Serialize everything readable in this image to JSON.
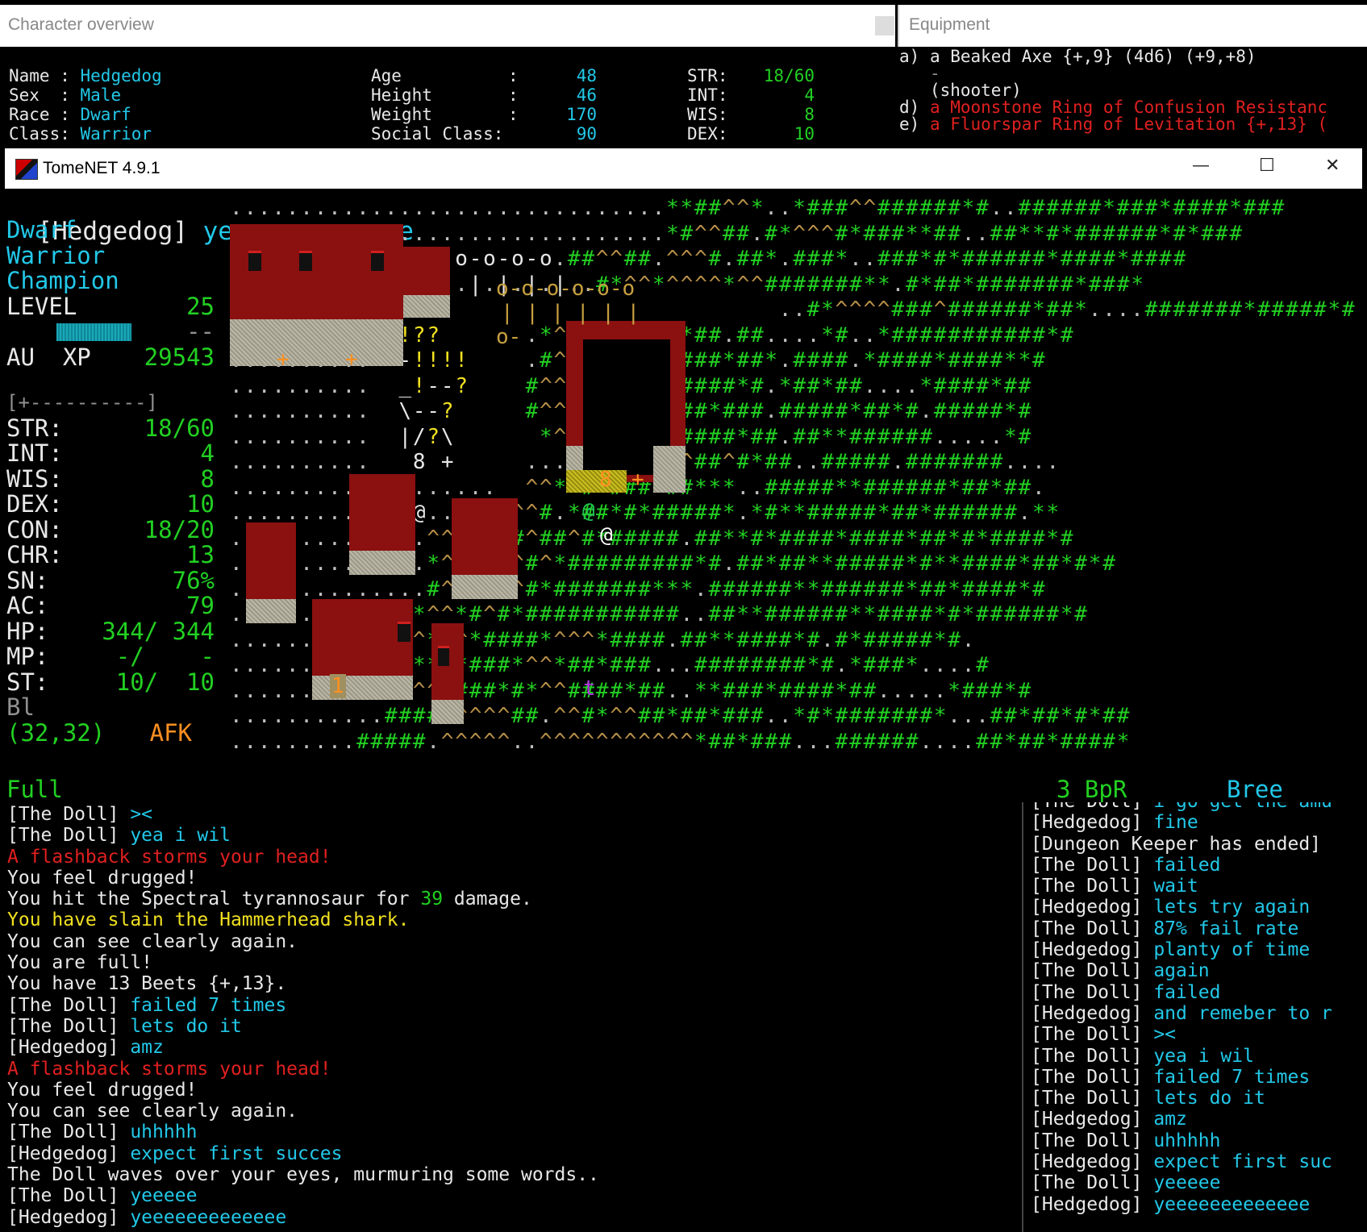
{
  "char_window": {
    "title": "Character overview",
    "name_label": "Name",
    "name": "Hedgedog",
    "sex_label": "Sex",
    "sex": "Male",
    "race_label": "Race",
    "race": "Dwarf",
    "class_label": "Class:",
    "class": "Warrior",
    "age_label": "Age",
    "age": "48",
    "height_label": "Height",
    "height": "46",
    "weight_label": "Weight",
    "weight": "170",
    "social_label": "Social Class:",
    "social": "90",
    "str_label": "STR:",
    "str": "18/60",
    "int_label": "INT:",
    "int": "4",
    "wis_label": "WIS:",
    "wis": "8",
    "dex_label": "DEX:",
    "dex": "10"
  },
  "equip_window": {
    "title": "Equipment",
    "lines": [
      {
        "slot": "a)",
        "text": "a Beaked Axe {+,9} (4d6) (+9,+8)",
        "color": "white"
      },
      {
        "slot": "",
        "text": "-",
        "color": "gray"
      },
      {
        "slot": "",
        "text": "(shooter)",
        "color": "white"
      },
      {
        "slot": "d)",
        "text": "a Moonstone Ring of Confusion Resistanc",
        "color": "red"
      },
      {
        "slot": "e)",
        "text": "a Fluorspar Ring of Levitation {+,13} (",
        "color": "red"
      }
    ]
  },
  "main_window": {
    "title": "TomeNET 4.9.1",
    "minimize": "—",
    "maximize": "☐",
    "close": "✕"
  },
  "top_message": {
    "speaker": "[Hedgedog]",
    "text": "yeeeeeeeeeeeee"
  },
  "sidebar": {
    "race": "Dwarf",
    "class": "Warrior",
    "title": "Champion",
    "level_label": "LEVEL",
    "level": "25",
    "xp_label": "XP",
    "xp_fraction": 0.62,
    "xp_tail": "--",
    "au_label": "AU",
    "au": "29543",
    "bar": "[+----------]",
    "stats": [
      {
        "label": "STR:",
        "value": "18/60",
        "color": "green"
      },
      {
        "label": "INT:",
        "value": "4",
        "color": "green"
      },
      {
        "label": "WIS:",
        "value": "8",
        "color": "green"
      },
      {
        "label": "DEX:",
        "value": "10",
        "color": "green"
      },
      {
        "label": "CON:",
        "value": "18/20",
        "color": "green"
      },
      {
        "label": "CHR:",
        "value": "13",
        "color": "green"
      },
      {
        "label": "SN:",
        "value": "76%",
        "color": "green"
      },
      {
        "label": "AC:",
        "value": "79",
        "color": "green"
      },
      {
        "label": "HP:",
        "value": "344/ 344",
        "color": "green"
      },
      {
        "label": "MP:",
        "value": "-/    -",
        "color": "green"
      },
      {
        "label": "ST:",
        "value": "10/  10",
        "color": "green"
      }
    ],
    "bl": "Bl",
    "coords": "(32,32)",
    "afk": "AFK"
  },
  "status_bar": {
    "food": "Full",
    "bpr": "3 BpR",
    "location": "Bree"
  },
  "map_rows": [
    "...............................**##^^*..*###^^######*#..######*###*####*###",
    "...............................*#^^##.#*^^^#*###**##..##**#*######*#*###",
    "............o-o-o-o-o-o.##^^##.^^^#.##*.###*..###*#*######*####*####",
    ".............|.|.|.|.|.|..#*^^*^^^^*^^#######**.#*##*#######*###*",
    "............o-                         ..#*^^^^###^######*##*....#######*#####*#",
    "..........  !??      .*^^^^#.#^#*##.##....*#..*###########*#",
    "..........  -!!!!    .#^^###^*#####*##*.####.*####*####**#",
    "..........  _!--?    #^^^###^.######*#.*##*##....*####*##",
    "..........  \\--?     #^^^######^##*###.#####*##*#.#####*#",
    "..........  |/?\\      *^^**##^######*##.##**######.....*#",
    "..........   8 +     ...^^^##^*^^##^#*##..#####.#######....",
    "...........@.......  ^^**#^###^##***..#####**######*##*##.",
    ".............@....*#^^#.*##*#*#####*.*#**#####*##*######.**",
    "..............^^***##^##^#*#####.##**#*####*####*##*#*####*#",
    "..............*^^###^#^*#########*#.##*##**#####*#**####*##*#*#",
    "..............#^^*##^#*#######***.######**######*##*####*#",
    ".............*^^*#^#*###########..##**######**####*#*######*#",
    "............^^*^^*####*^^^*####.##**####*#.#*#####*#.",
    "........t.#^^****###*^^*##*###...########*#.*###*....#",
    ".........*###^^*###*#*^^####*##..**###*####*##.....*###*#",
    "...........#####^^^^##.^^#*^^##*##*###..*#*#######*...##*##*#*##",
    ".........#####.^^^^^..^^^^^^^^^^^*##*###...######....##*##*####*"
  ],
  "shop_number": "1",
  "shop8": "8",
  "log": [
    [
      {
        "t": "[The Doll] ",
        "c": "white"
      },
      {
        "t": "><",
        "c": "cyan"
      }
    ],
    [
      {
        "t": "[The Doll] ",
        "c": "white"
      },
      {
        "t": "yea i wil",
        "c": "cyan"
      }
    ],
    [
      {
        "t": "A flashback storms your head!",
        "c": "red"
      }
    ],
    [
      {
        "t": "You feel drugged!",
        "c": "white"
      }
    ],
    [
      {
        "t": "You hit the Spectral tyrannosaur for ",
        "c": "white"
      },
      {
        "t": "39",
        "c": "green"
      },
      {
        "t": " damage.",
        "c": "white"
      }
    ],
    [
      {
        "t": "You have slain the Hammerhead shark.",
        "c": "yellow"
      }
    ],
    [
      {
        "t": "You can see clearly again.",
        "c": "white"
      }
    ],
    [
      {
        "t": "You are full!",
        "c": "white"
      }
    ],
    [
      {
        "t": "You have 13 Beets {+,13}.",
        "c": "white"
      }
    ],
    [
      {
        "t": "[The Doll] ",
        "c": "white"
      },
      {
        "t": "failed 7 times",
        "c": "cyan"
      }
    ],
    [
      {
        "t": "[The Doll] ",
        "c": "white"
      },
      {
        "t": "lets do it",
        "c": "cyan"
      }
    ],
    [
      {
        "t": "[Hedgedog] ",
        "c": "white"
      },
      {
        "t": "amz",
        "c": "cyan"
      }
    ],
    [
      {
        "t": "A flashback storms your head!",
        "c": "red"
      }
    ],
    [
      {
        "t": "You feel drugged!",
        "c": "white"
      }
    ],
    [
      {
        "t": "You can see clearly again.",
        "c": "white"
      }
    ],
    [
      {
        "t": "[The Doll] ",
        "c": "white"
      },
      {
        "t": "uhhhhh",
        "c": "cyan"
      }
    ],
    [
      {
        "t": "[Hedgedog] ",
        "c": "white"
      },
      {
        "t": "expect first succes",
        "c": "cyan"
      }
    ],
    [
      {
        "t": "The Doll waves over your eyes, murmuring some words..",
        "c": "white"
      }
    ],
    [
      {
        "t": "[The Doll] ",
        "c": "white"
      },
      {
        "t": "yeeeee",
        "c": "cyan"
      }
    ],
    [
      {
        "t": "[Hedgedog] ",
        "c": "white"
      },
      {
        "t": "yeeeeeeeeeeeee",
        "c": "cyan"
      }
    ]
  ],
  "chat": [
    [
      {
        "t": "[The Doll] ",
        "c": "white"
      },
      {
        "t": "i go get the amu",
        "c": "cyan"
      }
    ],
    [
      {
        "t": "[Hedgedog] ",
        "c": "white"
      },
      {
        "t": "fine",
        "c": "cyan"
      }
    ],
    [
      {
        "t": "[Dungeon Keeper has ended]",
        "c": "white"
      }
    ],
    [
      {
        "t": "[The Doll] ",
        "c": "white"
      },
      {
        "t": "failed",
        "c": "cyan"
      }
    ],
    [
      {
        "t": "[The Doll] ",
        "c": "white"
      },
      {
        "t": "wait",
        "c": "cyan"
      }
    ],
    [
      {
        "t": "[Hedgedog] ",
        "c": "white"
      },
      {
        "t": "lets try again",
        "c": "cyan"
      }
    ],
    [
      {
        "t": "[The Doll] ",
        "c": "white"
      },
      {
        "t": "87% fail rate",
        "c": "cyan"
      }
    ],
    [
      {
        "t": "[Hedgedog] ",
        "c": "white"
      },
      {
        "t": "planty of time",
        "c": "cyan"
      }
    ],
    [
      {
        "t": "[The Doll] ",
        "c": "white"
      },
      {
        "t": "again",
        "c": "cyan"
      }
    ],
    [
      {
        "t": "[The Doll] ",
        "c": "white"
      },
      {
        "t": "failed",
        "c": "cyan"
      }
    ],
    [
      {
        "t": "[Hedgedog] ",
        "c": "white"
      },
      {
        "t": "and remeber to r",
        "c": "cyan"
      }
    ],
    [
      {
        "t": "[The Doll] ",
        "c": "white"
      },
      {
        "t": "><",
        "c": "cyan"
      }
    ],
    [
      {
        "t": "[The Doll] ",
        "c": "white"
      },
      {
        "t": "yea i wil",
        "c": "cyan"
      }
    ],
    [
      {
        "t": "[The Doll] ",
        "c": "white"
      },
      {
        "t": "failed 7 times",
        "c": "cyan"
      }
    ],
    [
      {
        "t": "[The Doll] ",
        "c": "white"
      },
      {
        "t": "lets do it",
        "c": "cyan"
      }
    ],
    [
      {
        "t": "[Hedgedog] ",
        "c": "white"
      },
      {
        "t": "amz",
        "c": "cyan"
      }
    ],
    [
      {
        "t": "[The Doll] ",
        "c": "white"
      },
      {
        "t": "uhhhhh",
        "c": "cyan"
      }
    ],
    [
      {
        "t": "[Hedgedog] ",
        "c": "white"
      },
      {
        "t": "expect first suc",
        "c": "cyan"
      }
    ],
    [
      {
        "t": "[The Doll] ",
        "c": "white"
      },
      {
        "t": "yeeeee",
        "c": "cyan"
      }
    ],
    [
      {
        "t": "[Hedgedog] ",
        "c": "white"
      },
      {
        "t": "yeeeeeeeeeeeee",
        "c": "cyan"
      }
    ]
  ]
}
